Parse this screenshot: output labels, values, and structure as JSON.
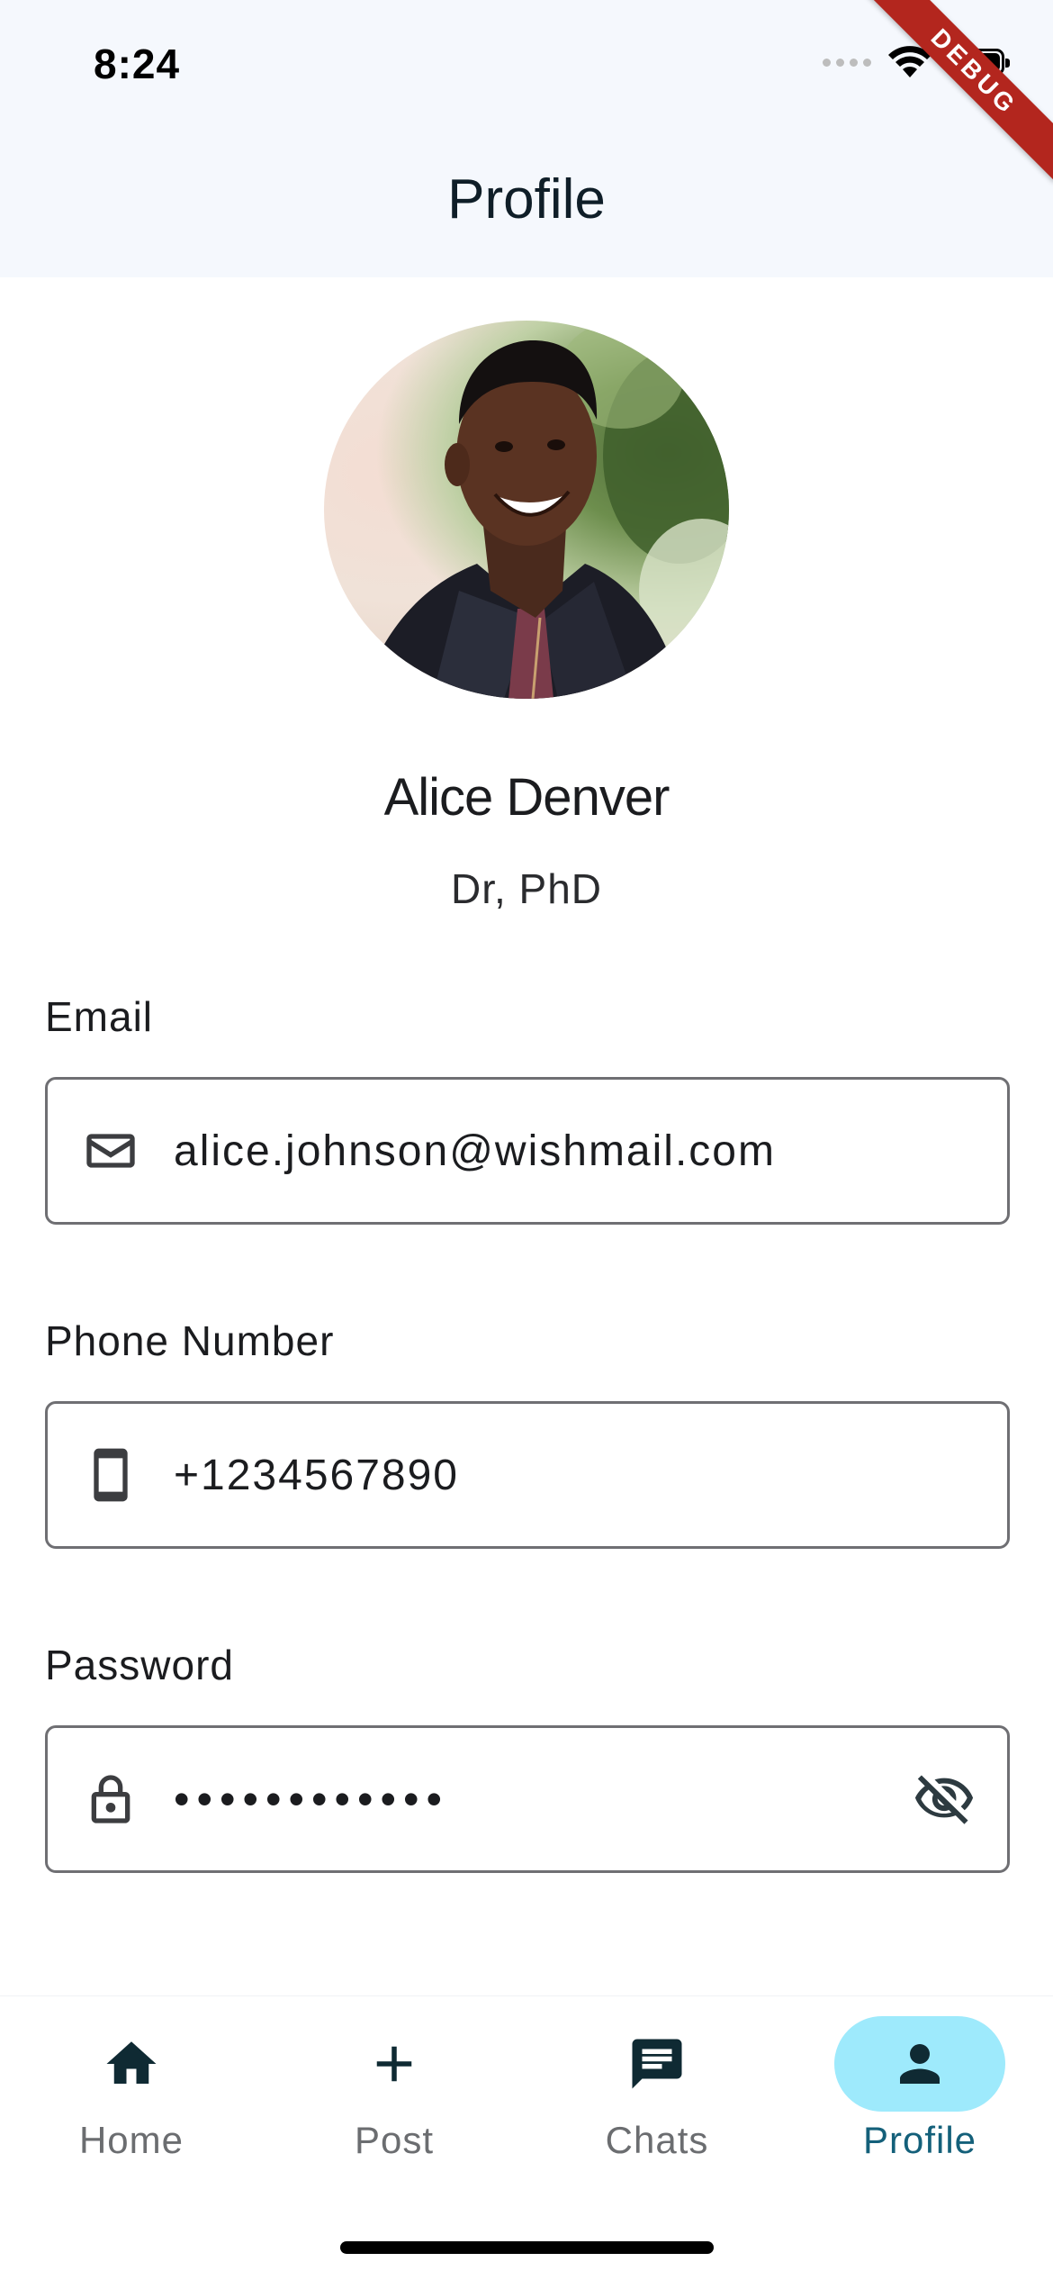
{
  "status_bar": {
    "time": "8:24",
    "debug_ribbon": "DEBUG"
  },
  "app_bar": {
    "title": "Profile"
  },
  "profile": {
    "name": "Alice Denver",
    "title": "Dr, PhD"
  },
  "fields": {
    "email": {
      "label": "Email",
      "value": "alice.johnson@wishmail.com",
      "icon": "mail-icon"
    },
    "phone": {
      "label": "Phone Number",
      "value": "+1234567890",
      "icon": "phone-icon"
    },
    "password": {
      "label": "Password",
      "value": "••••••••••••",
      "icon": "lock-icon",
      "trailing_icon": "visibility-off-icon"
    }
  },
  "bottom_nav": {
    "items": [
      {
        "label": "Home",
        "icon": "home-icon",
        "active": false
      },
      {
        "label": "Post",
        "icon": "plus-icon",
        "active": false
      },
      {
        "label": "Chats",
        "icon": "chat-icon",
        "active": false
      },
      {
        "label": "Profile",
        "icon": "person-icon",
        "active": true
      }
    ]
  },
  "colors": {
    "app_bar_bg": "#f5f8fd",
    "active_nav_pill": "#9eeafc",
    "active_nav_label": "#14607a",
    "icon_dark": "#0f2a33",
    "debug_ribbon": "#b3261e"
  }
}
